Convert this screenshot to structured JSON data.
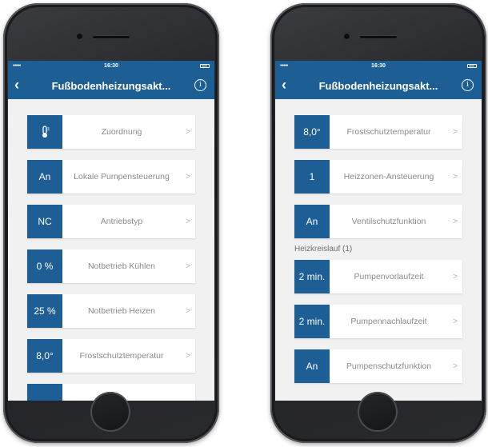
{
  "left": {
    "status": {
      "signal": "•••••",
      "time": "16:30"
    },
    "nav": {
      "back": "‹",
      "title": "Fußbodenheizungsakt...",
      "info": "i"
    },
    "rows": [
      {
        "value": "",
        "icon": "thermometer-icon",
        "label": "Zuordnung"
      },
      {
        "value": "An",
        "label": "Lokale Pumpensteuerung"
      },
      {
        "value": "NC",
        "label": "Antriebstyp"
      },
      {
        "value": "0 %",
        "label": "Notbetrieb Kühlen"
      },
      {
        "value": "25 %",
        "label": "Notbetrieb Heizen"
      },
      {
        "value": "8,0°",
        "label": "Frostschutztemperatur"
      }
    ]
  },
  "right": {
    "status": {
      "signal": "•••••",
      "time": "16:30"
    },
    "nav": {
      "back": "‹",
      "title": "Fußbodenheizungsakt...",
      "info": "i"
    },
    "rows_top": [
      {
        "value": "8,0°",
        "label": "Frostschutztemperatur"
      },
      {
        "value": "1",
        "label": "Heizzonen-Ansteuerung"
      },
      {
        "value": "An",
        "label": "Ventilschutzfunktion"
      }
    ],
    "section": "Heizkreislauf (1)",
    "rows_bottom": [
      {
        "value": "2 min.",
        "label": "Pumpenvorlaufzeit"
      },
      {
        "value": "2 min.",
        "label": "Pumpennachlaufzeit"
      },
      {
        "value": "An",
        "label": "Pumpenschutzfunktion"
      }
    ]
  },
  "chevron": ">",
  "colors": {
    "accent": "#1d5e95",
    "background": "#f1f1f1",
    "label": "#8a8a8a"
  }
}
